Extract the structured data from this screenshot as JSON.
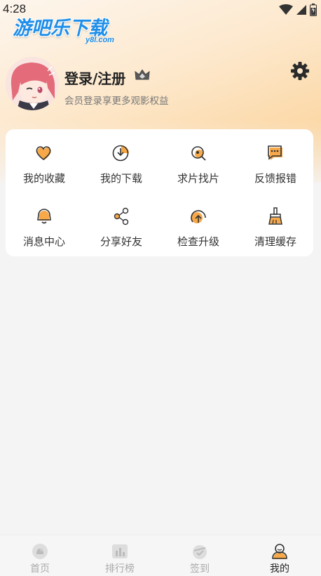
{
  "status": {
    "time": "4:28"
  },
  "watermark": {
    "title": "游吧乐下载",
    "sub": "y8l.com"
  },
  "profile": {
    "login_label": "登录/注册",
    "subtitle": "会员登录享更多观影权益"
  },
  "menu": {
    "items": [
      {
        "label": "我的收藏",
        "icon": "heart-icon"
      },
      {
        "label": "我的下载",
        "icon": "download-icon"
      },
      {
        "label": "求片找片",
        "icon": "search-movie-icon"
      },
      {
        "label": "反馈报错",
        "icon": "feedback-icon"
      },
      {
        "label": "消息中心",
        "icon": "bell-icon"
      },
      {
        "label": "分享好友",
        "icon": "share-icon"
      },
      {
        "label": "检查升级",
        "icon": "upgrade-icon"
      },
      {
        "label": "清理缓存",
        "icon": "broom-icon"
      }
    ]
  },
  "tabs": [
    {
      "label": "首页",
      "icon": "home-icon",
      "active": false
    },
    {
      "label": "排行榜",
      "icon": "ranking-icon",
      "active": false
    },
    {
      "label": "签到",
      "icon": "checkin-icon",
      "active": false
    },
    {
      "label": "我的",
      "icon": "profile-icon",
      "active": true
    }
  ],
  "colors": {
    "accent": "#f7a94a",
    "header_gradient_end": "#fbcf91",
    "watermark_blue": "#1f8ee8"
  }
}
